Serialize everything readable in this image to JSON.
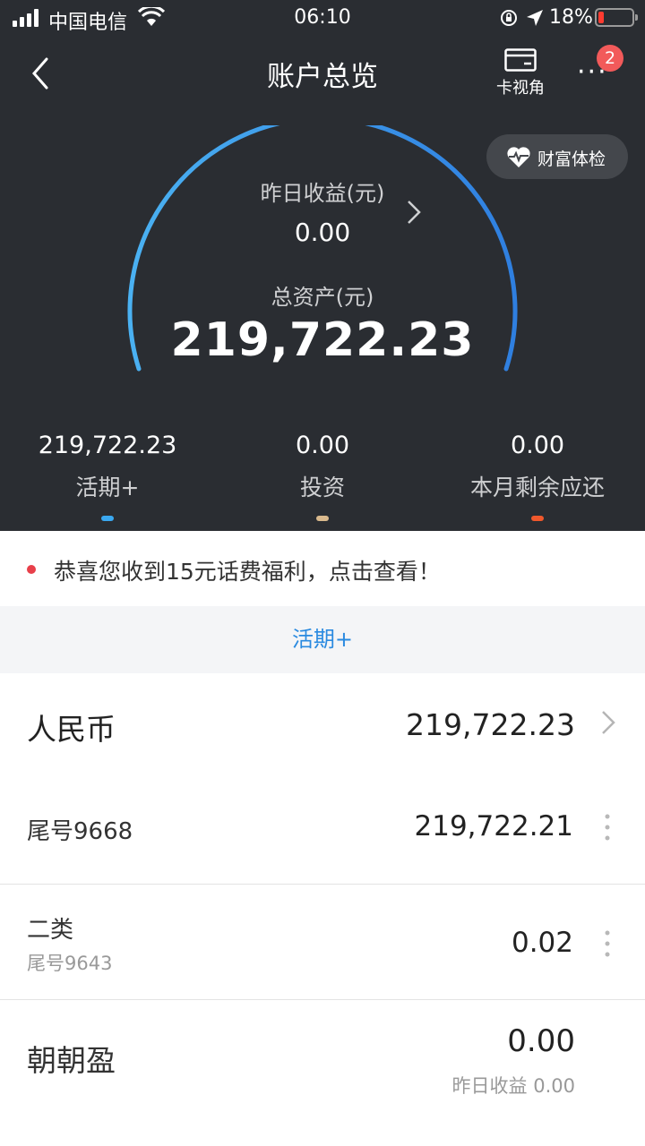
{
  "status_bar": {
    "carrier": "中国电信",
    "time": "06:10",
    "battery_percent": "18%",
    "battery_level": 0.18
  },
  "header": {
    "title": "账户总览",
    "card_view_label": "卡视角",
    "more_badge": "2"
  },
  "health_check": {
    "label": "财富体检"
  },
  "summary": {
    "yesterday_label": "昨日收益(元)",
    "yesterday_value": "0.00",
    "total_label": "总资产(元)",
    "total_value": "219,722.23"
  },
  "stats": [
    {
      "value": "219,722.23",
      "label": "活期+",
      "color": "#3aa8f0"
    },
    {
      "value": "0.00",
      "label": "投资",
      "color": "#d9b98d"
    },
    {
      "value": "0.00",
      "label": "本月剩余应还",
      "color": "#f0582c"
    }
  ],
  "notice": {
    "text": "恭喜您收到15元话费福利，点击查看！"
  },
  "section": {
    "title": "活期+"
  },
  "currency": {
    "name": "人民币",
    "amount": "219,722.23"
  },
  "accounts": [
    {
      "name": "尾号9668",
      "sub": "",
      "amount": "219,722.21"
    },
    {
      "name": "二类",
      "sub": "尾号9643",
      "amount": "0.02"
    }
  ],
  "product": {
    "name": "朝朝盈",
    "amount": "0.00",
    "yesterday_label": "昨日收益",
    "yesterday_value": "0.00"
  },
  "colors": {
    "header_bg": "#2a2d32",
    "accent": "#2a8ae0",
    "badge": "#f25a5a",
    "notice_dot": "#e8404a"
  }
}
